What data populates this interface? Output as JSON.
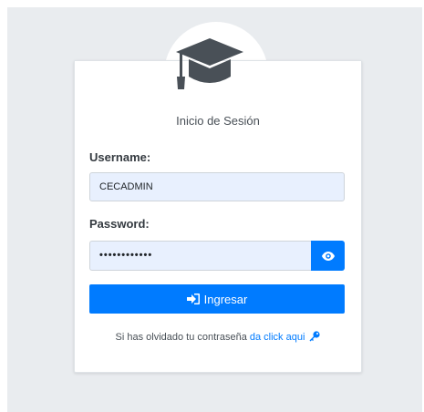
{
  "login": {
    "title": "Inicio de Sesión",
    "username_label": "Username:",
    "username_value": "CECADMIN",
    "password_label": "Password:",
    "password_value": "••••••••••••",
    "submit_label": "Ingresar",
    "forgot_text": "Si has olvidado tu contraseña ",
    "forgot_link": "da click aqui"
  },
  "icons": {
    "header": "graduation-cap-icon",
    "toggle": "eye-icon",
    "submit": "sign-in-icon",
    "forgot": "key-icon"
  },
  "colors": {
    "accent": "#007bff",
    "cap": "#495057",
    "input_bg": "#e8f0fe"
  }
}
